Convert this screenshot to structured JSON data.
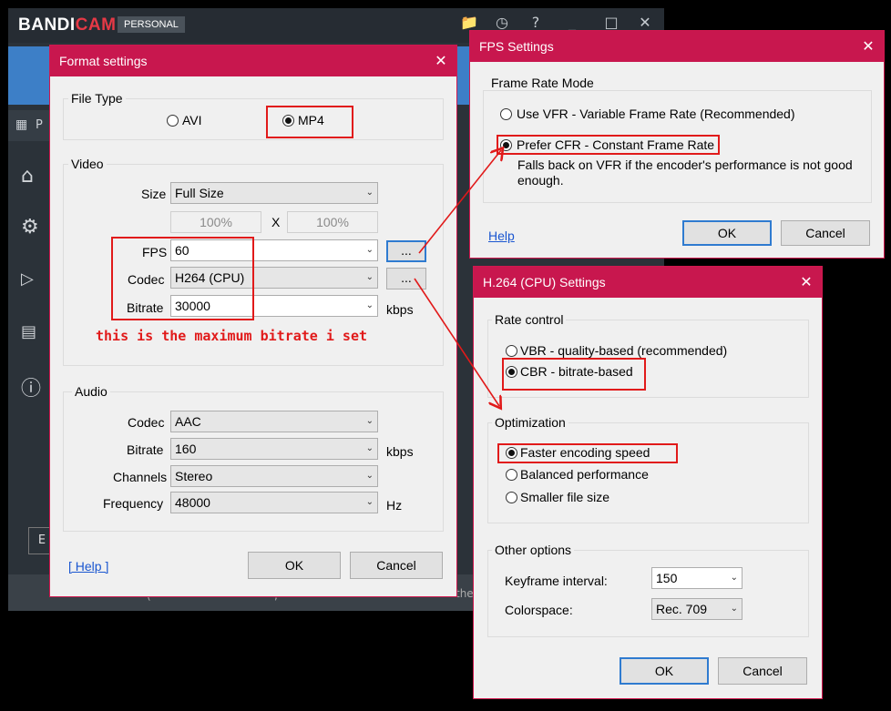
{
  "bandicam": {
    "logo_main": "BANDI",
    "logo_accent": "CAM",
    "edition": "PERSONAL",
    "strip_label": "P",
    "sidebar_button": "E",
    "bottom_text": "the",
    "bottom_sym1": "(",
    "bottom_sym2": ","
  },
  "format": {
    "title": "Format settings",
    "close": "✕",
    "file_type": {
      "label": "File Type",
      "avi": "AVI",
      "mp4": "MP4",
      "selected": "MP4"
    },
    "video": {
      "label": "Video",
      "size_label": "Size",
      "size_value": "Full Size",
      "width_pct": "100%",
      "x": "X",
      "height_pct": "100%",
      "fps_label": "FPS",
      "fps_value": "60",
      "codec_label": "Codec",
      "codec_value": "H264 (CPU)",
      "bitrate_label": "Bitrate",
      "bitrate_value": "30000",
      "bitrate_unit": "kbps",
      "more": "..."
    },
    "annotation": "this is the maximum bitrate i set",
    "audio": {
      "label": "Audio",
      "codec_label": "Codec",
      "codec_value": "AAC",
      "bitrate_label": "Bitrate",
      "bitrate_value": "160",
      "bitrate_unit": "kbps",
      "channels_label": "Channels",
      "channels_value": "Stereo",
      "frequency_label": "Frequency",
      "frequency_value": "48000",
      "frequency_unit": "Hz"
    },
    "help": "[ Help ]",
    "ok": "OK",
    "cancel": "Cancel"
  },
  "fps": {
    "title": "FPS Settings",
    "close": "✕",
    "group_label": "Frame Rate Mode",
    "vfr": "Use VFR - Variable Frame Rate (Recommended)",
    "cfr": "Prefer CFR - Constant Frame Rate",
    "note_line1": "Falls back on VFR if the encoder's performance is not good",
    "note_line2": "enough.",
    "selected": "cfr",
    "help": "Help",
    "ok": "OK",
    "cancel": "Cancel"
  },
  "h264": {
    "title": "H.264 (CPU) Settings",
    "close": "✕",
    "rate_label": "Rate control",
    "vbr": "VBR - quality-based (recommended)",
    "cbr": "CBR - bitrate-based",
    "rate_selected": "cbr",
    "opt_label": "Optimization",
    "opt_fast": "Faster encoding speed",
    "opt_balanced": "Balanced performance",
    "opt_small": "Smaller file size",
    "opt_selected": "fast",
    "other_label": "Other options",
    "keyframe_label": "Keyframe interval:",
    "keyframe_value": "150",
    "colorspace_label": "Colorspace:",
    "colorspace_value": "Rec. 709",
    "ok": "OK",
    "cancel": "Cancel"
  }
}
